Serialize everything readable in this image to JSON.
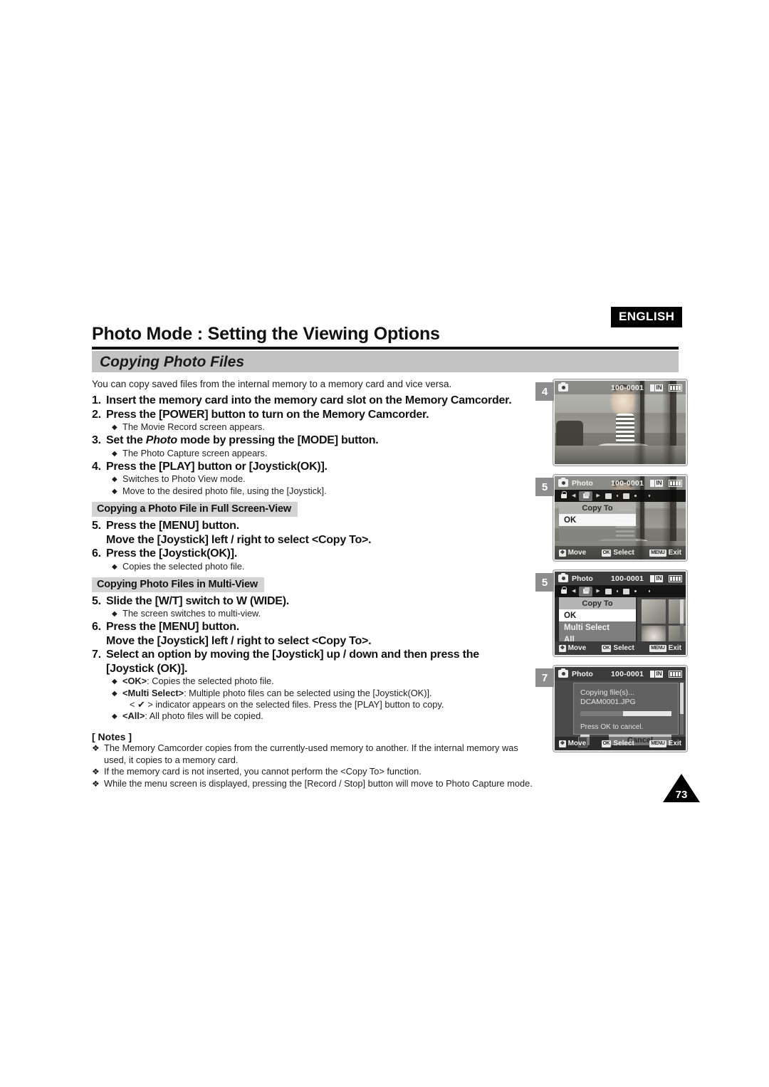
{
  "header": {
    "language_badge": "ENGLISH",
    "title": "Photo Mode : Setting the Viewing Options",
    "section_title": "Copying Photo Files"
  },
  "body": {
    "intro": "You can copy saved files from the internal memory to a memory card and vice versa.",
    "steps": [
      {
        "num": "1.",
        "text": "Insert the memory card into the memory card slot on the Memory Camcorder."
      },
      {
        "num": "2.",
        "text": "Press the [POWER] button to turn on the Memory Camcorder."
      },
      {
        "num": "3.",
        "text_pre": "Set the ",
        "text_italic": "Photo",
        "text_post": " mode by pressing the [MODE] button."
      },
      {
        "num": "4.",
        "text": "Press the [PLAY] button or [Joystick(OK)]."
      }
    ],
    "sub_2": "The Movie Record screen appears.",
    "sub_3": "The Photo Capture screen appears.",
    "sub_4a": "Switches to Photo View mode.",
    "sub_4b": "Move to the desired photo file, using the [Joystick].",
    "subhead_full": "Copying a Photo File in Full Screen-View",
    "step_5_full_l1": "Press the [MENU] button.",
    "step_5_full_l2": "Move the [Joystick] left / right to select <Copy To>.",
    "step_6_full": "Press the [Joystick(OK)].",
    "sub_6_full": "Copies the selected photo file.",
    "subhead_multi": "Copying Photo Files in Multi-View",
    "step_5_multi": "Slide the [W/T] switch to W (WIDE).",
    "sub_5_multi": "The screen switches to multi-view.",
    "step_6_multi_l1": "Press the [MENU] button.",
    "step_6_multi_l2": "Move the [Joystick] left / right to select <Copy To>.",
    "step_7_l1": "Select an option by moving the [Joystick] up / down and then press the",
    "step_7_l2": "[Joystick (OK)].",
    "opt_ok_b": "<OK>",
    "opt_ok_t": ": Copies the selected photo file.",
    "opt_multi_b": "<Multi Select>",
    "opt_multi_t": ": Multiple photo files can be selected using the [Joystick(OK)].",
    "opt_multi_t2": "< ✔ > indicator appears on the selected files. Press the [PLAY] button to copy.",
    "opt_all_b": "<All>",
    "opt_all_t": ": All photo files will be copied."
  },
  "notes": {
    "title": "[ Notes ]",
    "items": [
      "The Memory Camcorder copies from the currently-used memory to another. If the internal memory was used, it copies to a memory card.",
      "If the memory card is not inserted, you cannot perform the <Copy To> function.",
      "While the menu screen is displayed, pressing the [Record / Stop] button will move to Photo Capture mode."
    ]
  },
  "screens": [
    {
      "step": "4",
      "mode": "",
      "counter": "100-0001",
      "memory": "IN"
    },
    {
      "step": "5",
      "mode": "Photo",
      "counter": "100-0001",
      "memory": "IN",
      "panel_title": "Copy To",
      "options": [
        "OK"
      ],
      "bottom": {
        "move": "Move",
        "select": "Select",
        "exit": "Exit",
        "move_key": "✥",
        "select_key": "OK",
        "exit_key": "MENU"
      }
    },
    {
      "step": "5",
      "mode": "Photo",
      "counter": "100-0001",
      "memory": "IN",
      "panel_title": "Copy To",
      "options": [
        "OK",
        "Multi Select",
        "All"
      ],
      "bottom": {
        "move": "Move",
        "select": "Select",
        "exit": "Exit",
        "move_key": "✥",
        "select_key": "OK",
        "exit_key": "MENU"
      }
    },
    {
      "step": "7",
      "mode": "Photo",
      "counter": "100-0001",
      "memory": "IN",
      "dialog": {
        "line1": "Copying file(s)...",
        "line2": "DCAM0001.JPG",
        "line3": "Press OK to cancel.",
        "cancel": "Cancel",
        "progress": 47
      },
      "bottom": {
        "move": "Move",
        "select": "Select",
        "exit": "Exit",
        "move_key": "✥",
        "select_key": "OK",
        "exit_key": "MENU"
      }
    }
  ],
  "footer": {
    "page_number": "73"
  },
  "colors": {
    "band": "#c3c3c3",
    "subhead": "#d3d3d3",
    "badge": "#8d8d8d",
    "ink": "#111111"
  }
}
